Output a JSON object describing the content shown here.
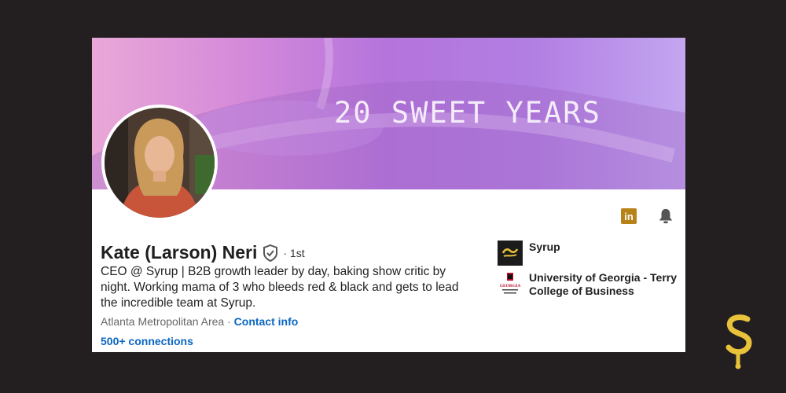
{
  "banner": {
    "text": "20 SWEET YEARS"
  },
  "profile": {
    "name": "Kate (Larson) Neri",
    "degree": "· 1st",
    "headline": "CEO @ Syrup | B2B growth leader by day, baking show critic by night. Working mama of 3 who bleeds red & black and gets to lead the incredible team at Syrup.",
    "location": "Atlanta Metropolitan Area ·",
    "contact_label": "Contact info",
    "connections": "500+ connections"
  },
  "actions": {
    "linkedin_icon": "linkedin-icon",
    "bell_icon": "bell-icon",
    "linkedin_text": "in"
  },
  "orgs": [
    {
      "name": "Syrup",
      "logo": "syrup-logo"
    },
    {
      "name": "University of Georgia - Terry College of Business",
      "logo": "uga-logo",
      "logo_text": "GEORGIA"
    }
  ],
  "colors": {
    "page_bg": "#231f20",
    "link": "#0a66c2",
    "linkedin_badge": "#b78218",
    "syrup_gold": "#e8c23a"
  }
}
